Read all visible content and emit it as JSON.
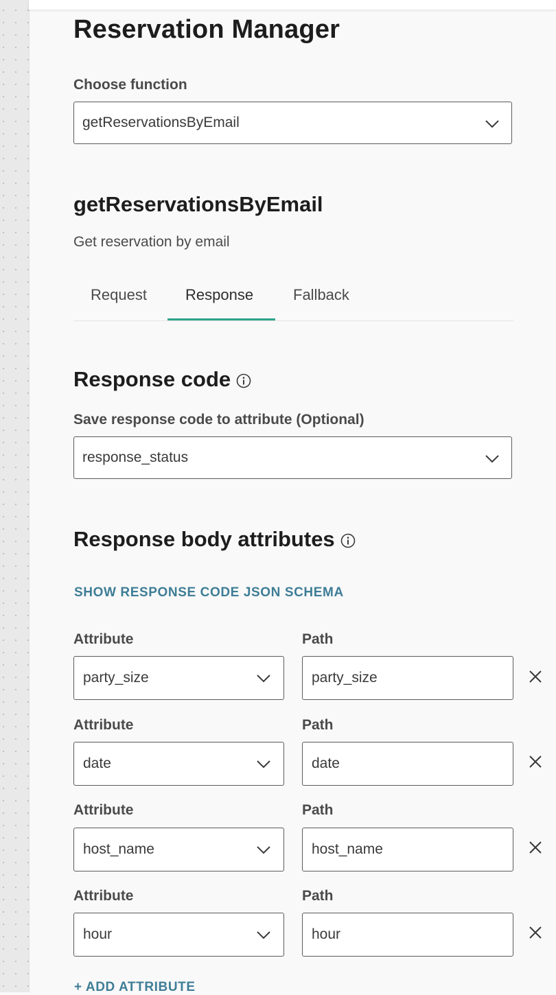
{
  "panel": {
    "title": "Reservation Manager",
    "choose_function_label": "Choose function",
    "selected_function": "getReservationsByEmail",
    "function_name": "getReservationsByEmail",
    "function_description": "Get reservation by email"
  },
  "tabs": [
    {
      "label": "Request",
      "active": false
    },
    {
      "label": "Response",
      "active": true
    },
    {
      "label": "Fallback",
      "active": false
    }
  ],
  "response_code": {
    "heading": "Response code",
    "save_label": "Save response code to attribute (Optional)",
    "selected_attribute": "response_status"
  },
  "response_body": {
    "heading": "Response body attributes",
    "show_schema_link": "SHOW RESPONSE CODE JSON SCHEMA",
    "attribute_label": "Attribute",
    "path_label": "Path",
    "rows": [
      {
        "attribute": "party_size",
        "path": "party_size"
      },
      {
        "attribute": "date",
        "path": "date"
      },
      {
        "attribute": "host_name",
        "path": "host_name"
      },
      {
        "attribute": "hour",
        "path": "hour"
      }
    ],
    "add_attribute_link": "+ ADD ATTRIBUTE"
  },
  "icons": {
    "chevron": "chevron-down-icon",
    "info": "info-icon",
    "close": "close-icon"
  },
  "colors": {
    "accent_tab": "#2fa38a",
    "link": "#3e7d96",
    "border": "#5a5a5a",
    "background": "#f9f9f9"
  }
}
